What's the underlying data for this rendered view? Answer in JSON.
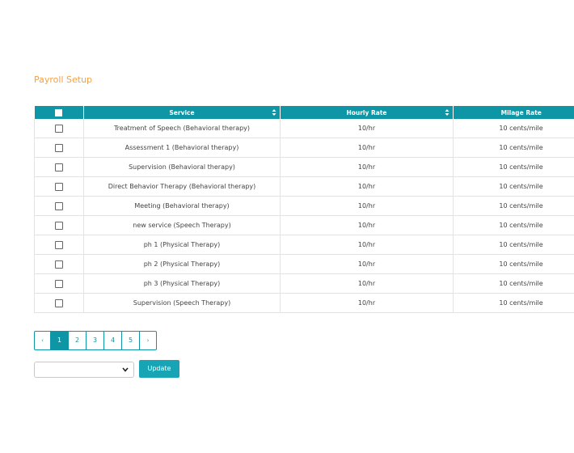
{
  "page_title": "Payroll Setup",
  "table": {
    "headers": [
      "",
      "Service",
      "Hourly Rate",
      "Milage Rate"
    ],
    "rows": [
      {
        "service": "Treatment of Speech (Behavioral therapy)",
        "hourly_rate": "10/hr",
        "milage_rate": "10 cents/mile"
      },
      {
        "service": "Assessment 1 (Behavioral therapy)",
        "hourly_rate": "10/hr",
        "milage_rate": "10 cents/mile"
      },
      {
        "service": "Supervision (Behavioral therapy)",
        "hourly_rate": "10/hr",
        "milage_rate": "10 cents/mile"
      },
      {
        "service": "Direct Behavior Therapy (Behavioral therapy)",
        "hourly_rate": "10/hr",
        "milage_rate": "10 cents/mile"
      },
      {
        "service": "Meeting (Behavioral therapy)",
        "hourly_rate": "10/hr",
        "milage_rate": "10 cents/mile"
      },
      {
        "service": "new service (Speech Therapy)",
        "hourly_rate": "10/hr",
        "milage_rate": "10 cents/mile"
      },
      {
        "service": "ph 1 (Physical Therapy)",
        "hourly_rate": "10/hr",
        "milage_rate": "10 cents/mile"
      },
      {
        "service": "ph 2 (Physical Therapy)",
        "hourly_rate": "10/hr",
        "milage_rate": "10 cents/mile"
      },
      {
        "service": "ph 3 (Physical Therapy)",
        "hourly_rate": "10/hr",
        "milage_rate": "10 cents/mile"
      },
      {
        "service": "Supervision (Speech Therapy)",
        "hourly_rate": "10/hr",
        "milage_rate": "10 cents/mile"
      }
    ]
  },
  "pagination": {
    "prev": "‹",
    "pages": [
      "1",
      "2",
      "3",
      "4",
      "5"
    ],
    "active_page": "1",
    "next": "›"
  },
  "actions": {
    "select_value": "",
    "update_label": "Update"
  },
  "colors": {
    "accent": "#0e96a7",
    "title": "#f7a043",
    "button": "#17a5b5"
  }
}
